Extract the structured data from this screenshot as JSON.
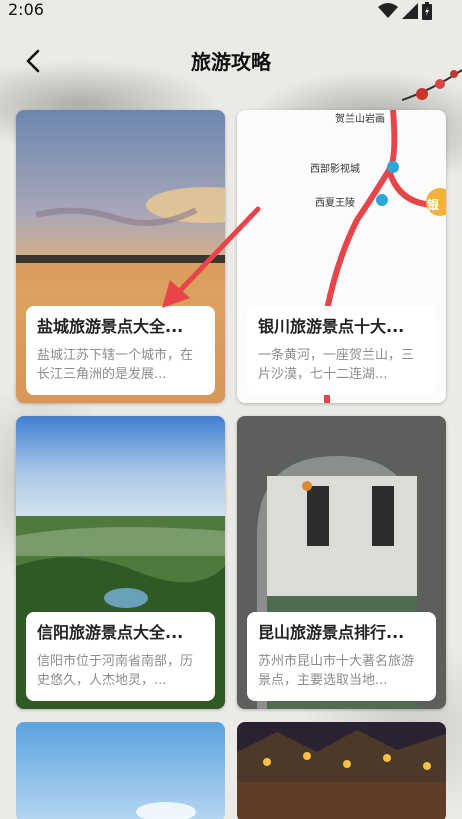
{
  "status": {
    "time": "2:06"
  },
  "header": {
    "title": "旅游攻略"
  },
  "cards": [
    {
      "title": "盐城旅游景点大全...",
      "desc": "盐城江苏下辖一个城市，在长江三角洲的是发展..."
    },
    {
      "title": "银川旅游景点十大...",
      "desc": "一条黄河，一座贺兰山，三片沙漠，七十二连湖..."
    },
    {
      "title": "信阳旅游景点大全...",
      "desc": "信阳市位于河南省南部，历史悠久，人杰地灵，..."
    },
    {
      "title": "昆山旅游景点排行...",
      "desc": "苏州市昆山市十大著名旅游景点，主要选取当地..."
    }
  ],
  "map_labels": {
    "top": "贺兰山岩画",
    "a": "西部影视城",
    "b": "西夏王陵",
    "c": "银川"
  },
  "icons": {
    "back": "back-arrow-icon",
    "wifi": "wifi-icon",
    "signal": "signal-icon",
    "battery": "battery-icon"
  },
  "colors": {
    "annotation_arrow": "#e8454b",
    "map_route": "#e8454b",
    "map_station": "#2ea5d8"
  }
}
